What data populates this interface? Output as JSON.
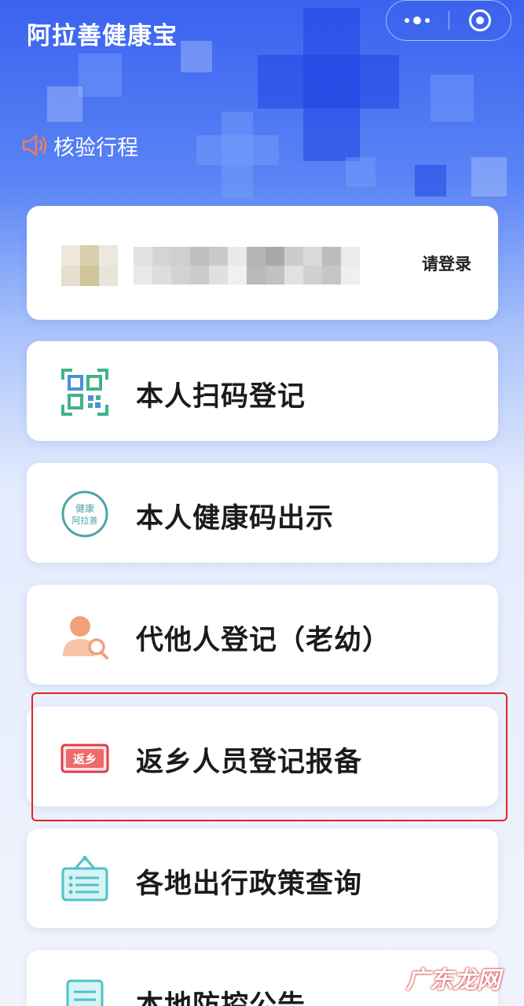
{
  "app": {
    "title": "阿拉善健康宝"
  },
  "notice": {
    "text": "核验行程"
  },
  "profile": {
    "login_label": "请登录"
  },
  "menu": [
    {
      "label": "本人扫码登记",
      "icon": "qr-scan-icon"
    },
    {
      "label": "本人健康码出示",
      "icon": "health-code-badge-icon"
    },
    {
      "label": "代他人登记（老幼）",
      "icon": "person-search-icon"
    },
    {
      "label": "返乡人员登记报备",
      "icon": "return-home-icon",
      "highlighted": true
    },
    {
      "label": "各地出行政策查询",
      "icon": "policy-board-icon"
    },
    {
      "label": "本地防控公告",
      "icon": "announcement-doc-icon"
    }
  ],
  "badge_texts": {
    "health_top": "健康",
    "health_bottom": "阿拉善",
    "return_home": "返乡"
  },
  "watermark": {
    "text": "广东龙网"
  },
  "colors": {
    "header_blue": "#3a62f0",
    "highlight_red": "#e0232a",
    "qr_green": "#3fb38a",
    "qr_blue": "#4a90d9",
    "person_orange": "#f0a07a",
    "return_red": "#d9404a",
    "policy_teal": "#4ec3c9"
  }
}
